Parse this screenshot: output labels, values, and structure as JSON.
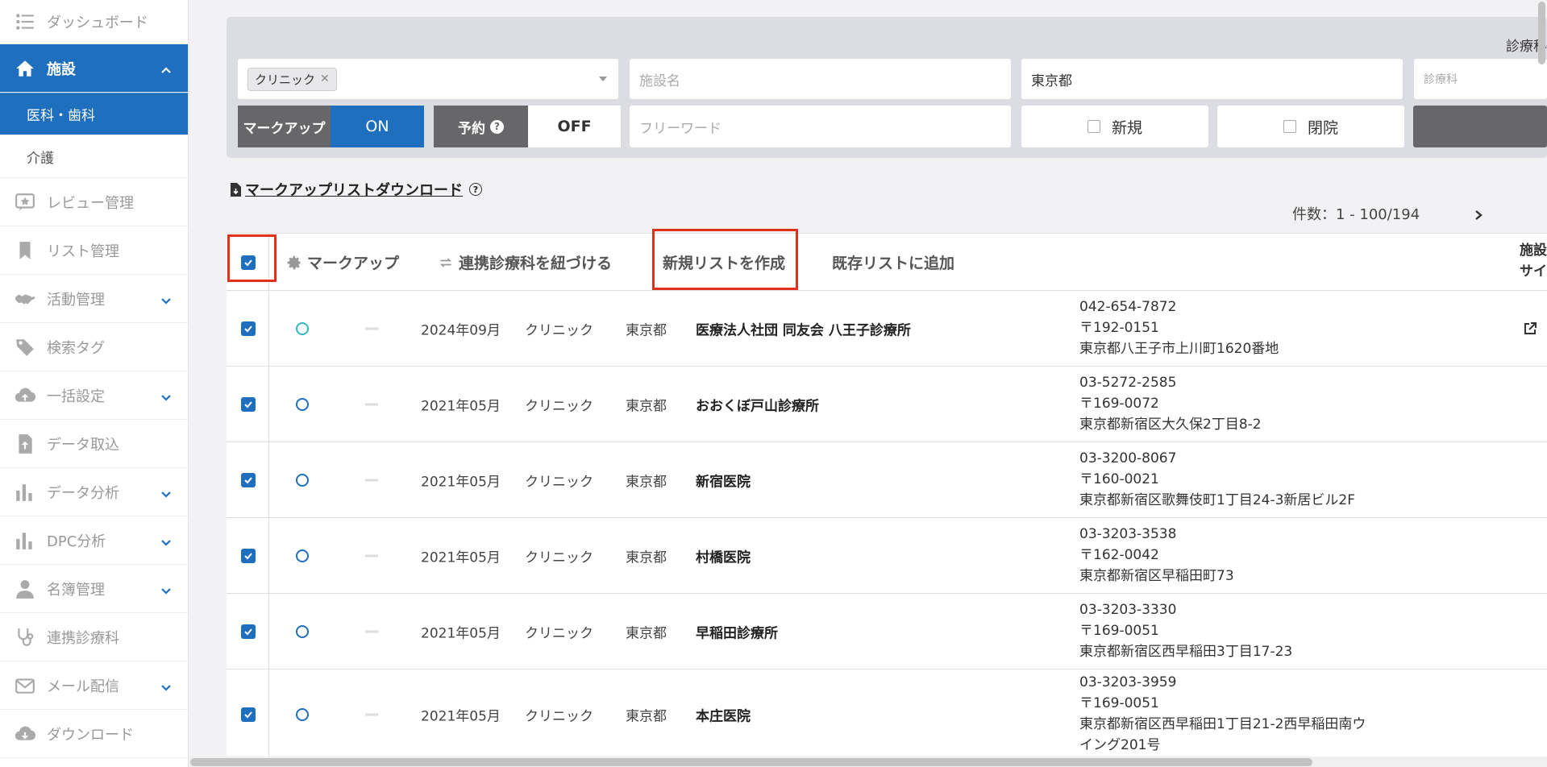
{
  "sidebar": {
    "items": [
      {
        "label": "ダッシュボード",
        "icon": "list-icon"
      },
      {
        "label": "施設",
        "icon": "home-icon",
        "active": true,
        "expanded": true
      },
      {
        "label": "レビュー管理",
        "icon": "star-review-icon"
      },
      {
        "label": "リスト管理",
        "icon": "bookmark-icon"
      },
      {
        "label": "活動管理",
        "icon": "handshake-icon",
        "has_children": true
      },
      {
        "label": "検索タグ",
        "icon": "tag-icon"
      },
      {
        "label": "一括設定",
        "icon": "cloud-upload-icon",
        "has_children": true
      },
      {
        "label": "データ取込",
        "icon": "file-upload-icon"
      },
      {
        "label": "データ分析",
        "icon": "bar-chart-icon",
        "has_children": true
      },
      {
        "label": "DPC分析",
        "icon": "bar-chart-icon",
        "has_children": true
      },
      {
        "label": "名簿管理",
        "icon": "person-icon",
        "has_children": true
      },
      {
        "label": "連携診療科",
        "icon": "stethoscope-icon"
      },
      {
        "label": "メール配信",
        "icon": "mail-icon",
        "has_children": true
      },
      {
        "label": "ダウンロード",
        "icon": "cloud-download-icon"
      }
    ],
    "sub_items": [
      {
        "label": "医科・歯科",
        "active": true
      },
      {
        "label": "介護",
        "active": false
      }
    ]
  },
  "filters": {
    "right_label": "診療科",
    "facility_type_chip": "クリニック",
    "facility_name_placeholder": "施設名",
    "prefecture_value": "東京都",
    "department_placeholder": "診療科",
    "markup_label": "マークアップ",
    "markup_state": "ON",
    "reservation_label": "予約",
    "reservation_state": "OFF",
    "freeword_placeholder": "フリーワード",
    "new_label": "新規",
    "closed_label": "閉院"
  },
  "download_link": "マークアップリストダウンロード",
  "count_text": "件数：1 - 100/194",
  "toolbar": {
    "markup": "マークアップ",
    "link_departments": "連携診療科を紐づける",
    "create_list": "新規リストを作成",
    "add_to_list": "既存リストに追加",
    "right_header_line1": "施設",
    "right_header_line2": "サイ"
  },
  "colors": {
    "primary": "#1f6fbf",
    "highlight": "#e0301e",
    "panel": "#dcdde3",
    "dark_label": "#676769"
  },
  "rows": [
    {
      "date": "2024年09月",
      "type": "クリニック",
      "pref": "東京都",
      "name": "医療法人社団 同友会 八王子診療所",
      "phone": "042-654-7872",
      "zip": "〒192-0151",
      "address": "東京都八王子市上川町1620番地",
      "circle": "teal",
      "has_external_link": true
    },
    {
      "date": "2021年05月",
      "type": "クリニック",
      "pref": "東京都",
      "name": "おおくぼ戸山診療所",
      "phone": "03-5272-2585",
      "zip": "〒169-0072",
      "address": "東京都新宿区大久保2丁目8-2",
      "circle": "blue"
    },
    {
      "date": "2021年05月",
      "type": "クリニック",
      "pref": "東京都",
      "name": "新宿医院",
      "phone": "03-3200-8067",
      "zip": "〒160-0021",
      "address": "東京都新宿区歌舞伎町1丁目24-3新居ビル2F",
      "circle": "blue"
    },
    {
      "date": "2021年05月",
      "type": "クリニック",
      "pref": "東京都",
      "name": "村橋医院",
      "phone": "03-3203-3538",
      "zip": "〒162-0042",
      "address": "東京都新宿区早稲田町73",
      "circle": "blue"
    },
    {
      "date": "2021年05月",
      "type": "クリニック",
      "pref": "東京都",
      "name": "早稲田診療所",
      "phone": "03-3203-3330",
      "zip": "〒169-0051",
      "address": "東京都新宿区西早稲田3丁目17-23",
      "circle": "blue"
    },
    {
      "date": "2021年05月",
      "type": "クリニック",
      "pref": "東京都",
      "name": "本庄医院",
      "phone": "03-3203-3959",
      "zip": "〒169-0051",
      "address": "東京都新宿区西早稲田1丁目21-2西早稲田南ウ",
      "address2": "イング201号",
      "circle": "blue"
    }
  ]
}
